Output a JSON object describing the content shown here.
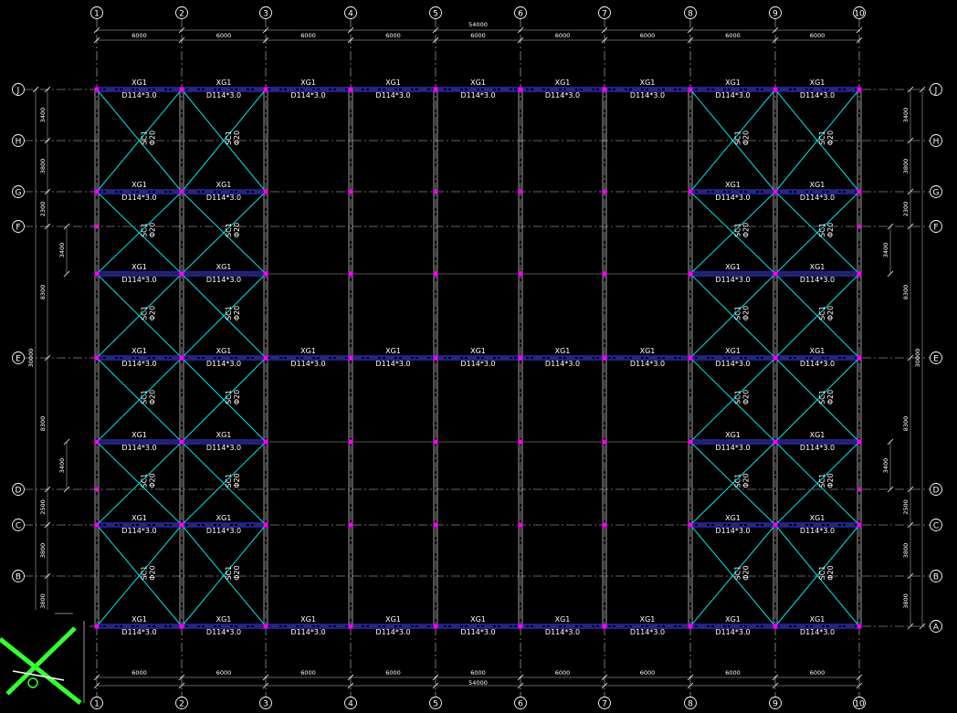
{
  "drawing": {
    "total_dimension": "54000",
    "bay_dimension": "6000",
    "column_axes": [
      "1",
      "2",
      "3",
      "4",
      "5",
      "6",
      "7",
      "8",
      "9",
      "10"
    ],
    "row_axes": [
      "J",
      "H",
      "G",
      "F",
      "E",
      "D",
      "C",
      "B",
      "A"
    ],
    "left_row_dims": [
      "3400",
      "3800",
      "2300",
      "8300",
      "30000",
      "8300",
      "2500",
      "3800",
      "3800"
    ],
    "right_row_dims": [
      "3400",
      "3800",
      "2300",
      "8300",
      "30000",
      "8300",
      "2500",
      "3800",
      "3800"
    ],
    "sub_dims": [
      "3400",
      "3400"
    ],
    "tie_label": "XG1",
    "tie_section": "D114*3.0",
    "brace_label": "SC1",
    "brace_section": "Φ20",
    "colors": {
      "background": "#000000",
      "grid": "#c8c8c8",
      "tie_beam": "#2d2dff",
      "brace": "#00e5e5",
      "text": "#ffffff",
      "node": "#ff00ff",
      "detail": "#33ff33"
    }
  }
}
